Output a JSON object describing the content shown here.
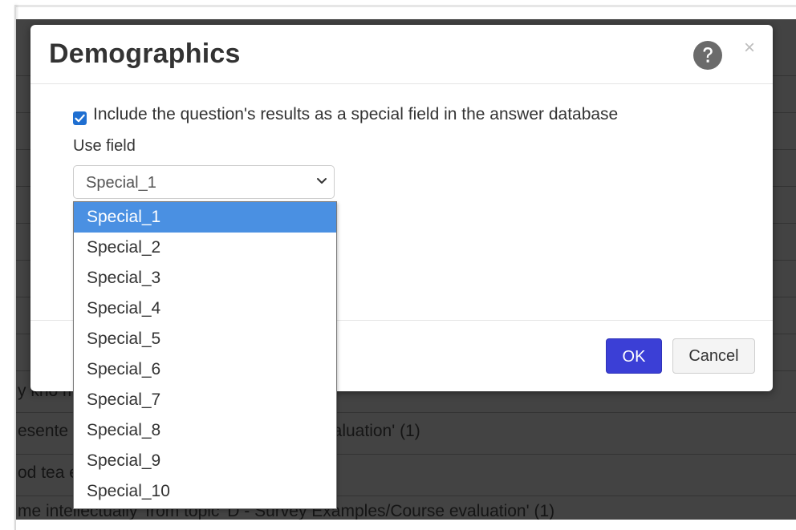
{
  "dialog": {
    "title": "Demographics",
    "help_icon": "help-circle-icon",
    "close_label": "×",
    "include_checkbox_checked": true,
    "include_label": "Include the question's results as a special field in the answer database",
    "use_field_label": "Use field",
    "selected_field": "Special_1",
    "ok_label": "OK",
    "cancel_label": "Cancel"
  },
  "dropdown": {
    "options": [
      "Special_1",
      "Special_2",
      "Special_3",
      "Special_4",
      "Special_5",
      "Special_6",
      "Special_7",
      "Special_8",
      "Special_9",
      "Special_10"
    ],
    "highlighted_index": 0
  },
  "background_rows": [
    "y kno                                                   mples/Course evaluation' (1)",
    "esente                                                 ic 'D - Survey Examples/Course evaluation' (1)",
    "od tea                                                 es/Course evaluation' (1)",
    "me intellectually' from topic 'D - Survey Examples/Course evaluation' (1)"
  ],
  "colors": {
    "ok_button": "#3b3fd6",
    "option_highlight": "#4a90e2",
    "checkbox": "#1f6fd1",
    "backdrop": "#434343"
  }
}
